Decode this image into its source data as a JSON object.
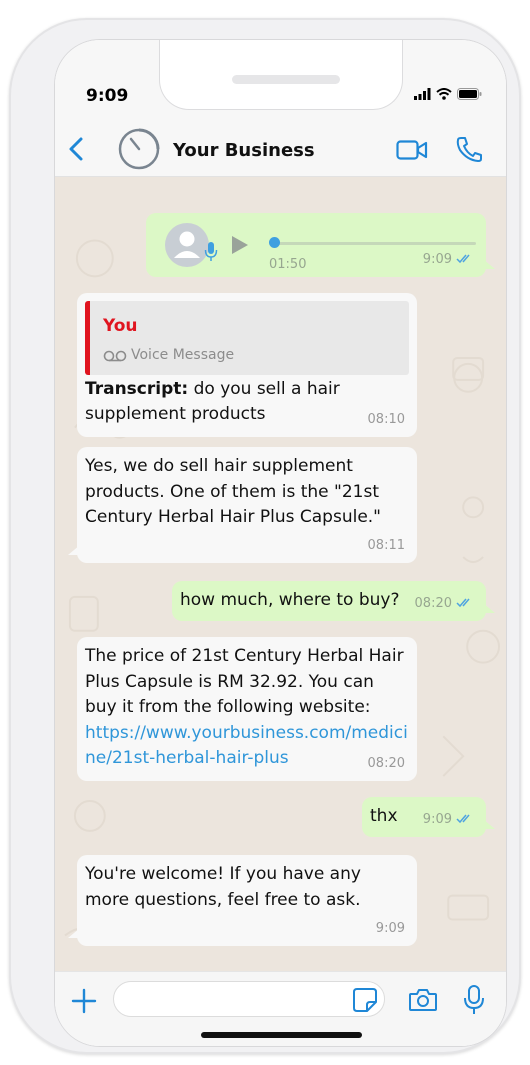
{
  "status_bar": {
    "time": "9:09"
  },
  "header": {
    "business_name": "Your Business"
  },
  "messages": {
    "voice": {
      "duration": "01:50",
      "time": "9:09"
    },
    "m1": {
      "quote_author": "You",
      "quote_label": "Voice Message",
      "transcript_label": "Transcript:",
      "line1": "do you sell a hair",
      "line2": "supplement products",
      "time": "08:10"
    },
    "m2": {
      "line1": "Yes, we do sell hair supplement",
      "line2": "products. One of them is the \"21st",
      "line3": "Century Herbal Hair Plus Capsule.\"",
      "time": "08:11"
    },
    "m3": {
      "text": "how much, where to buy?",
      "time": "08:20"
    },
    "m4": {
      "line1": "The price of 21st Century Herbal Hair",
      "line2": "Plus Capsule is RM 32.92. You can",
      "line3": "buy it from the following website:",
      "link_line1": "https://www.yourbusiness.com/medici",
      "link_line2": "ne/21st-herbal-hair-plus",
      "time": "08:20"
    },
    "m5": {
      "text": "thx",
      "time": "9:09"
    },
    "m6": {
      "line1": "You're welcome! If you have any",
      "line2": "more questions, feel free to ask.",
      "time": "9:09"
    }
  },
  "input": {
    "placeholder": ""
  },
  "colors": {
    "accent_blue": "#1f87d6",
    "outgoing_bubble": "#dcf8c6",
    "incoming_bubble": "#f8f8f8",
    "quote_red": "#e0141f",
    "chat_bg": "#ece5dd",
    "read_ticks": "#4fa3e0"
  },
  "icons": [
    "back-chevron-icon",
    "timer-icon",
    "video-call-icon",
    "phone-icon",
    "avatar-icon",
    "mic-icon",
    "play-icon",
    "read-ticks-icon",
    "voicemail-icon",
    "plus-icon",
    "sticker-icon",
    "camera-icon",
    "signal-icon",
    "wifi-icon",
    "battery-icon"
  ]
}
